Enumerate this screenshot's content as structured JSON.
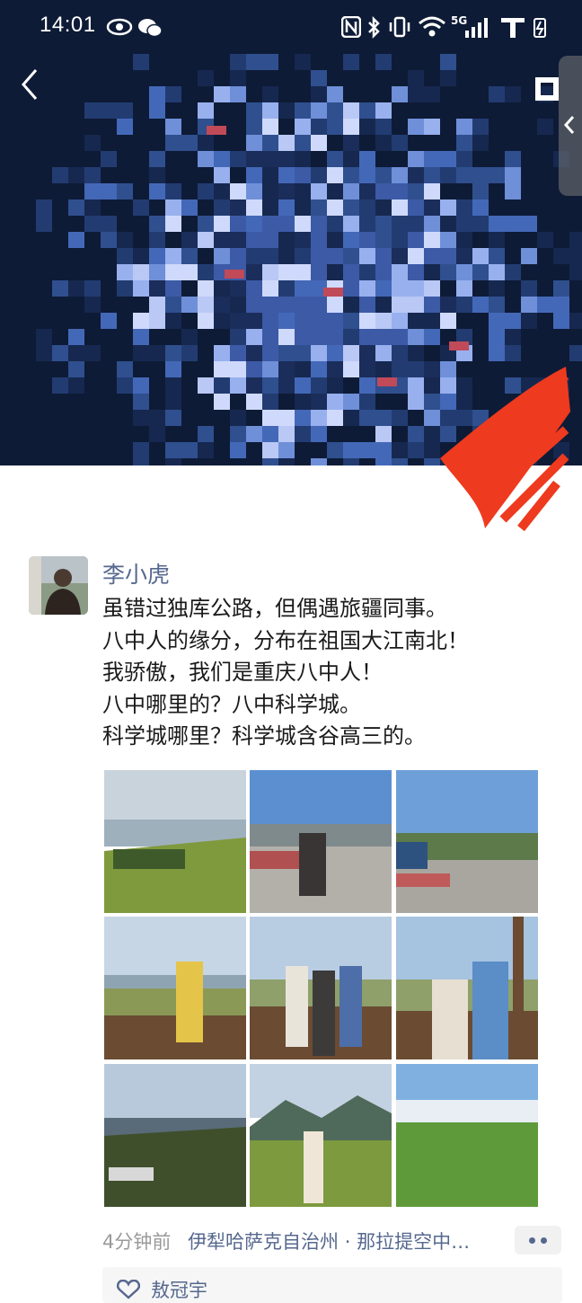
{
  "status_bar": {
    "time": "14:01",
    "network": "5G"
  },
  "cover": {
    "description_icon": "cover-photo"
  },
  "post": {
    "author": "李小虎",
    "text_lines": [
      "虽错过独库公路，但偶遇旅疆同事。",
      "八中人的缘分，分布在祖国大江南北！",
      "我骄傲，我们是重庆八中人！",
      "八中哪里的？八中科学城。",
      "科学城哪里？科学城含谷高三的。"
    ],
    "photos": [
      "grassland-hill-trees",
      "family-at-visitor-center",
      "visitor-center-plaza",
      "boy-on-viewing-deck",
      "group-on-viewing-deck",
      "couple-on-viewing-deck",
      "grassland-valley",
      "woman-on-meadow",
      "green-meadow-clouds"
    ],
    "time_ago": "4分钟前",
    "location": "伊犁哈萨克自治州 · 那拉提空中…",
    "likes": {
      "names": "敖冠宇"
    }
  },
  "colors": {
    "link": "#56688e",
    "text": "#1a1a1a",
    "muted": "#9a9a9a"
  }
}
